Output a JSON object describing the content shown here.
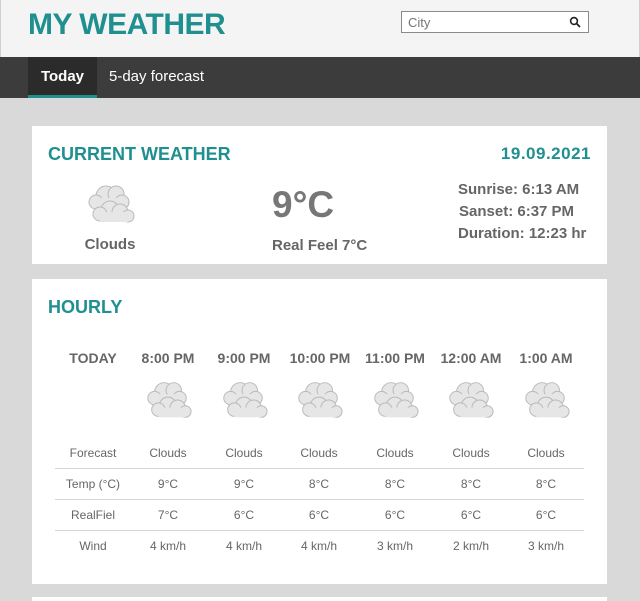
{
  "app": {
    "title": "MY WEATHER"
  },
  "search": {
    "placeholder": "City"
  },
  "nav": {
    "tabs": [
      {
        "label": "Today",
        "active": true
      },
      {
        "label": "5-day forecast",
        "active": false
      }
    ]
  },
  "current": {
    "title": "CURRENT WEATHER",
    "date": "19.09.2021",
    "condition": "Clouds",
    "temp": "9°C",
    "real_feel": "Real Feel 7°C",
    "sunrise": "Sunrise: 6:13 AM",
    "sunset": "Sanset: 6:37 PM",
    "duration": "Duration: 12:23 hr"
  },
  "hourly": {
    "title": "HOURLY",
    "today_label": "TODAY",
    "row_labels": [
      "Forecast",
      "Temp (°C)",
      "RealFiel",
      "Wind"
    ],
    "columns": [
      {
        "time": "8:00 PM",
        "forecast": "Clouds",
        "temp": "9°C",
        "real": "7°C",
        "wind": "4 km/h"
      },
      {
        "time": "9:00 PM",
        "forecast": "Clouds",
        "temp": "9°C",
        "real": "6°C",
        "wind": "4 km/h"
      },
      {
        "time": "10:00 PM",
        "forecast": "Clouds",
        "temp": "8°C",
        "real": "6°C",
        "wind": "4 km/h"
      },
      {
        "time": "11:00 PM",
        "forecast": "Clouds",
        "temp": "8°C",
        "real": "6°C",
        "wind": "3 km/h"
      },
      {
        "time": "12:00 AM",
        "forecast": "Clouds",
        "temp": "8°C",
        "real": "6°C",
        "wind": "2 km/h"
      },
      {
        "time": "1:00 AM",
        "forecast": "Clouds",
        "temp": "8°C",
        "real": "6°C",
        "wind": "3 km/h"
      }
    ]
  },
  "colors": {
    "accent": "#1f8f8f",
    "nav_bg": "#3c3c3c",
    "page_bg": "#d9d9d9"
  },
  "icons": {
    "weather": "clouds-icon",
    "search": "search-icon"
  }
}
